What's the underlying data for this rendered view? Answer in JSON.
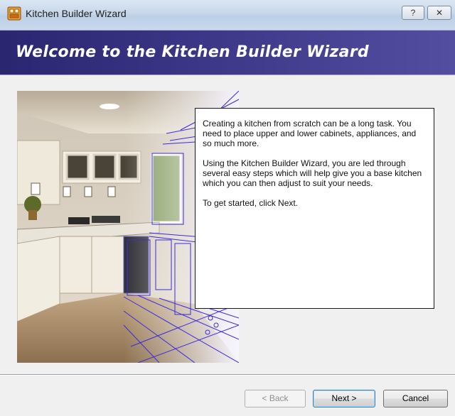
{
  "window": {
    "title": "Kitchen Builder Wizard",
    "help_button": "?",
    "close_button": "✕"
  },
  "banner": {
    "title": "Welcome to the Kitchen Builder Wizard"
  },
  "intro": {
    "paragraph1": "Creating a kitchen from scratch can be a long task.  You need to place upper and lower cabinets, appliances, and so much more.",
    "paragraph2": "Using the Kitchen Builder Wizard, you are led through several easy steps which will help give you a base kitchen which you can then adjust to suit your needs.",
    "paragraph3": "To get started, click Next."
  },
  "buttons": {
    "back": "< Back",
    "next": "Next >",
    "cancel": "Cancel"
  },
  "colors": {
    "banner_dark": "#2b2670",
    "banner_light": "#534ea0",
    "wireframe": "#3d2bd8"
  }
}
